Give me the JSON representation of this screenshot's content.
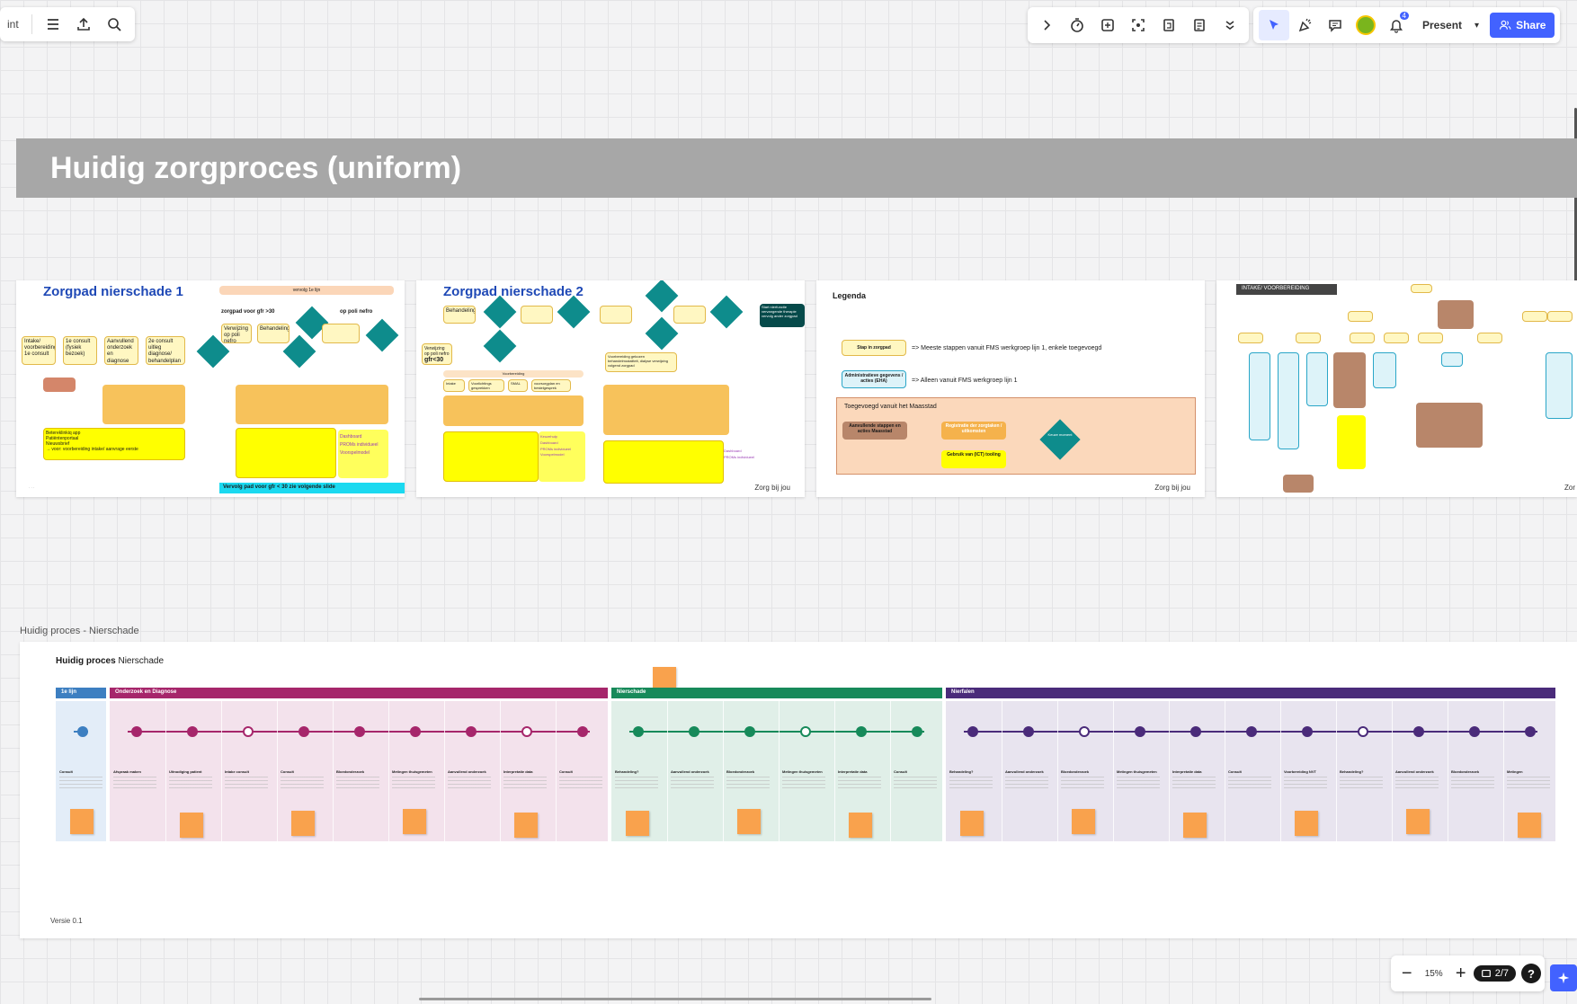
{
  "toolbar_left": {
    "app_name_fragment": "int",
    "icons": [
      "menu-icon",
      "upload-icon",
      "search-icon"
    ]
  },
  "toolbar_right": {
    "present_label": "Present",
    "share_label": "Share",
    "notification_count": "4"
  },
  "banner": {
    "title": "Huidig zorgproces (uniform)"
  },
  "slides": {
    "s1": {
      "title": "Zorgpad nierschade 1",
      "top_label": "vervolg 1e lijn",
      "pathway_label": "zorgpad voor gfr >30",
      "poli_label": "op poli nefro",
      "verwijzing": "Verwijzing op poli nefro",
      "behandeling": "Behandeling",
      "box1": "Intake/ voorbereiding 1e consult",
      "box2": "1e consult (fysiek bezoek)",
      "box3": "Aanvullend onderzoek en diagnose",
      "box4": "2e consult uitleg diagnose/ behandelplan",
      "app_text": "Betereklinkiq app\nPatiëntenportaal\nNieuwsbrief\n→ voor: voorbereiding intake/ aanvrage eerste",
      "tags": [
        "Dashboard",
        "PROMs individueel",
        "Voorspelmodel"
      ],
      "bottom_bar": "Vervolg pad voor gfr < 30 zie volgende slide"
    },
    "s2": {
      "title": "Zorgpad nierschade 2",
      "behandeling": "Behandeling",
      "verwijzing": "Verwijzing op poli nefro",
      "gfr": "gfr<30",
      "followup_label": "Voorbereiding",
      "pill1": "Intake",
      "pill2": "Voorlichtings gesprekken",
      "pill3": "SMAL",
      "pill4": "voorsorgplan en bestelgesprek",
      "tags": [
        "Keuzehulp",
        "Dashboard",
        "PROMs individueel",
        "Voorspelmodel"
      ],
      "tags_right": [
        "Dashboard",
        "PROMs individueel"
      ],
      "start_box": "Start nierfunctie vervangende therapie vervolg ander zorgpad",
      "dialysis_box": "Voorbereiding gekozen behandelmodaliteit, dialyse verwijzing volgend zorgpad",
      "brand": "Zorg bij jou"
    },
    "s3": {
      "title": "Legenda",
      "stap_label": "Stap in zorgpad",
      "stap_text": "=> Meeste stappen vanuit FMS werkgroep lijn 1, enkele toegevoegd",
      "admin_label": "Administratieve gegevens / acties (EHA)",
      "admin_text": "=> Alleen vanuit FMS werkgroep lijn 1",
      "maastad_title": "Toegevoegd vanuit het Maasstad",
      "box_a": "Aanvullende stappen en acties Maasstad",
      "box_b": "Registratie der zorgtaken / uitkomsten",
      "box_c": "Gebruik van (ICT) tooling",
      "diamond": "Keuze moment",
      "brand": "Zorg bij jou"
    },
    "s4": {
      "header_tag": "INTAKE/ VOORBEREIDING",
      "brand": "Zor"
    }
  },
  "process": {
    "frame_label": "Huidig proces - Nierschade",
    "title_bold": "Huidig proces",
    "title_rest": " Nierschade",
    "phases": [
      {
        "label": "1e lijn",
        "color": "#3d7fc1"
      },
      {
        "label": "Onderzoek en Diagnose",
        "color": "#a6266b"
      },
      {
        "label": "Nierschade",
        "color": "#178a5a"
      },
      {
        "label": "Nierfalen",
        "color": "#4a2b7a"
      }
    ],
    "columns": [
      "Consult",
      "Afspraak maken",
      "Uitnodiging patient",
      "Intake consult",
      "Consult",
      "Bloedonderzoek",
      "Metingen thuisgemeten",
      "Aanvullend onderzoek",
      "Interpretatie data",
      "Consult",
      "Behandeling?",
      "Aanvullend onderzoek",
      "Bloedonderzoek",
      "Metingen thuisgemeten",
      "Interpretatie data",
      "Consult",
      "Behandeling?",
      "Aanvullend onderzoek",
      "Bloedonderzoek",
      "Metingen thuisgemeten",
      "Interpretatie data",
      "Consult",
      "Voorbereiding NVT",
      "Behandeling?",
      "Aanvullend onderzoek",
      "Bloedonderzoek",
      "Metingen"
    ],
    "version": "Versie 0.1"
  },
  "bottom_bar": {
    "zoom": "15%",
    "page_indicator": "2/7",
    "help": "?"
  },
  "colors": {
    "accent": "#4262ff",
    "banner": "#a7a7a7",
    "slide_title": "#1f49b6",
    "teal": "#0e8c8c"
  }
}
